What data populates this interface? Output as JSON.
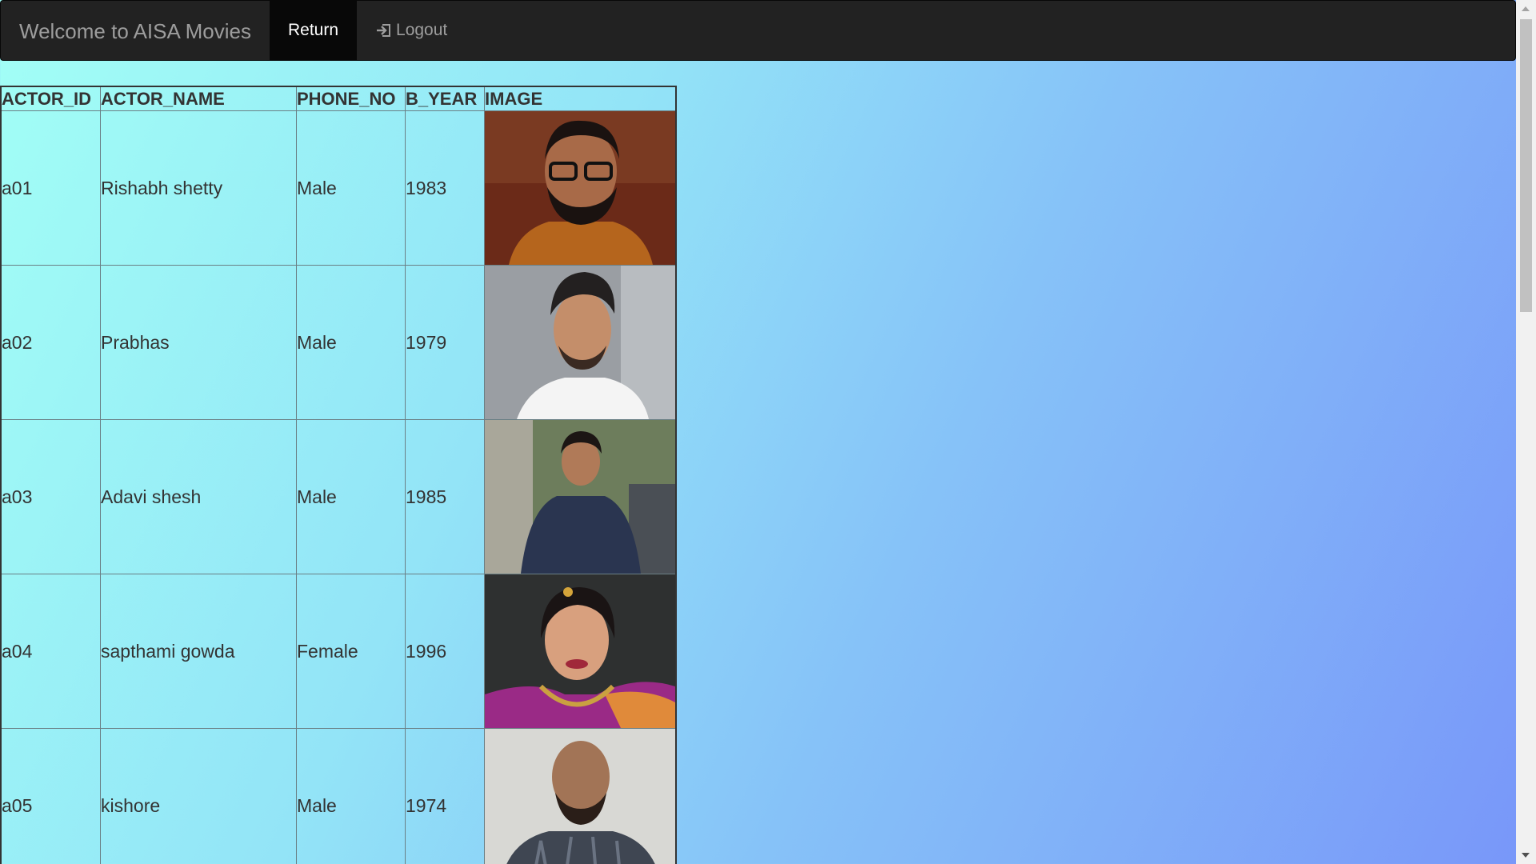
{
  "navbar": {
    "brand": "Welcome to AISA Movies",
    "return_label": "Return",
    "logout_label": "Logout",
    "logout_icon": "log-in-icon"
  },
  "table": {
    "headers": [
      "ACTOR_ID",
      "ACTOR_NAME",
      "PHONE_NO",
      "B_YEAR",
      "IMAGE"
    ],
    "rows": [
      {
        "id": "a01",
        "name": "Rishabh shetty",
        "phone": "Male",
        "year": "1983",
        "image": "actor-photo"
      },
      {
        "id": "a02",
        "name": "Prabhas",
        "phone": "Male",
        "year": "1979",
        "image": "actor-photo"
      },
      {
        "id": "a03",
        "name": "Adavi shesh",
        "phone": "Male",
        "year": "1985",
        "image": "actor-photo"
      },
      {
        "id": "a04",
        "name": "sapthami gowda",
        "phone": "Female",
        "year": "1996",
        "image": "actress-photo"
      },
      {
        "id": "a05",
        "name": "kishore",
        "phone": "Male",
        "year": "1974",
        "image": "actor-photo"
      }
    ]
  },
  "colors": {
    "navbar_bg": "#222222",
    "navbar_active": "#080808",
    "gradient_start": "#a2fff6",
    "gradient_end": "#7896f9"
  }
}
